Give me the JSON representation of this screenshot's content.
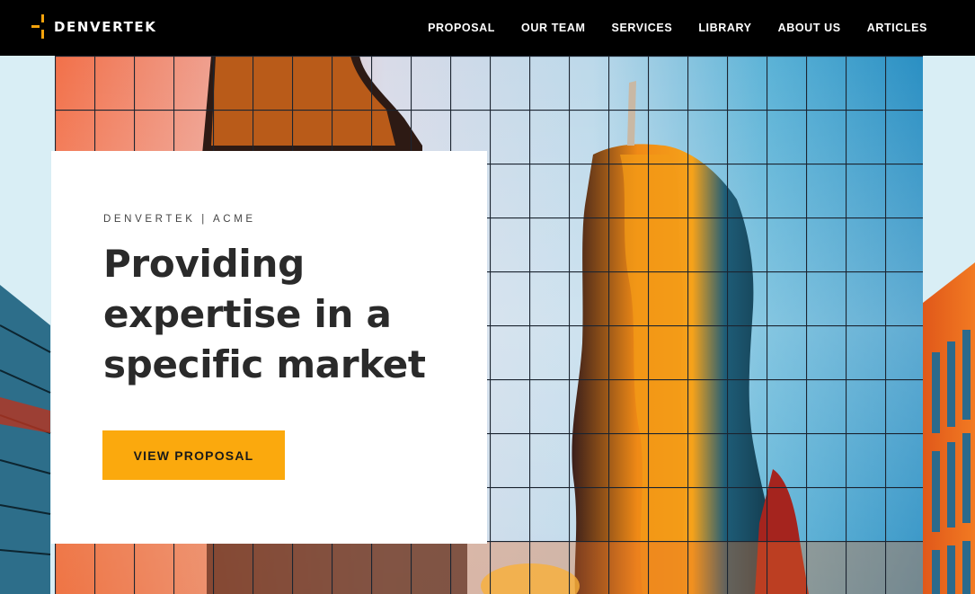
{
  "brand": {
    "name": "DENVERTEK",
    "accent_color": "#f5a30c"
  },
  "nav": {
    "items": [
      {
        "label": "PROPOSAL"
      },
      {
        "label": "OUR TEAM"
      },
      {
        "label": "SERVICES"
      },
      {
        "label": "LIBRARY"
      },
      {
        "label": "ABOUT US"
      },
      {
        "label": "ARTICLES"
      }
    ]
  },
  "hero": {
    "eyebrow": "DENVERTEK | ACME",
    "headline": "Providing expertise in a specific market",
    "cta_label": "VIEW PROPOSAL",
    "cta_color": "#fba90d",
    "image_icon": "glass-building-reflection-photo"
  }
}
